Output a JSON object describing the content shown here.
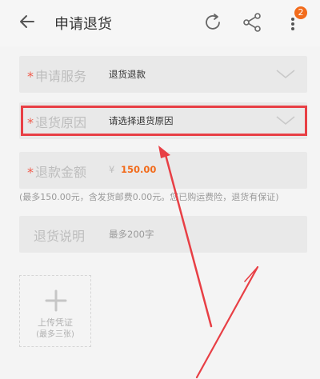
{
  "header": {
    "title": "申请退货",
    "badge_count": "2"
  },
  "form": {
    "service": {
      "label": "申请服务",
      "value": "退货退款"
    },
    "reason": {
      "label": "退货原因",
      "placeholder": "请选择退货原因"
    },
    "amount": {
      "label": "退款金额",
      "currency": "¥",
      "value": "150.00"
    },
    "hint": "(最多150.00元，含发货邮费0.00元。您已购运费险，退货有保证)",
    "note": {
      "label": "退货说明",
      "placeholder": "最多200字"
    }
  },
  "upload": {
    "label": "上传凭证",
    "sub": "(最多三张)"
  },
  "colors": {
    "required_star": "#f15a4a",
    "price": "#f26b1b",
    "highlight": "#e83f45",
    "annotation_arrow": "#e83f45"
  },
  "icons": [
    "back-arrow-icon",
    "refresh-icon",
    "share-icon",
    "more-vertical-icon",
    "chevron-down-icon",
    "plus-icon"
  ]
}
